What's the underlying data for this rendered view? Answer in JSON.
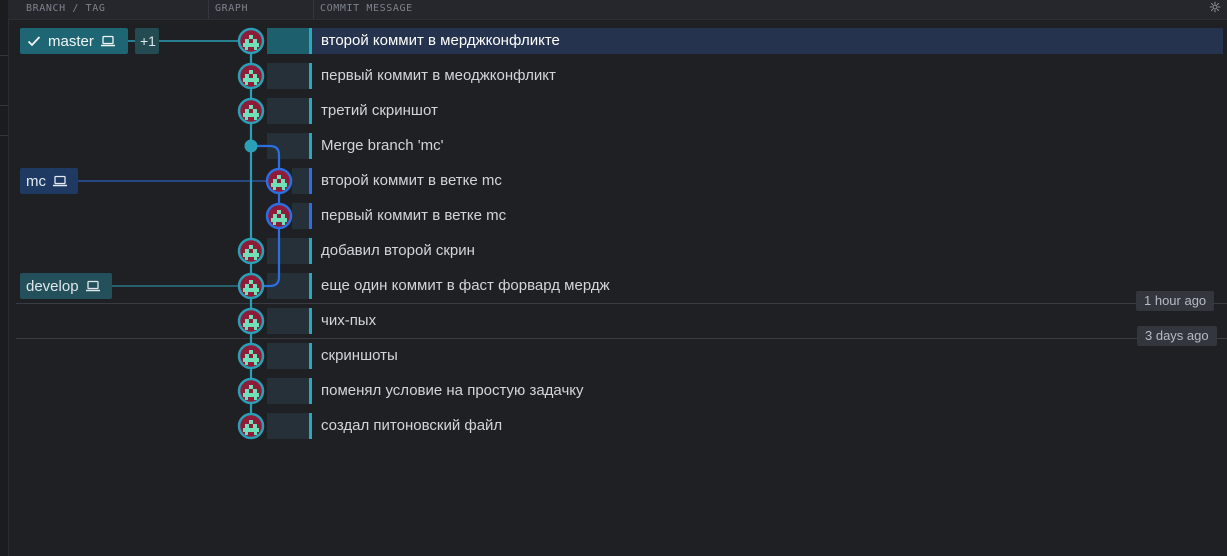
{
  "header": {
    "col_branch": "BRANCH / TAG",
    "col_graph": "GRAPH",
    "col_message": "COMMIT MESSAGE",
    "settings_icon": "gear-icon"
  },
  "refs": {
    "master": {
      "label": "master",
      "check_icon": "checkmark-icon",
      "local_icon": "laptop-icon",
      "extra": "+1"
    },
    "mc": {
      "label": "mc",
      "local_icon": "laptop-icon"
    },
    "develop": {
      "label": "develop",
      "local_icon": "laptop-icon"
    }
  },
  "commits": [
    {
      "message": "второй коммит в мерджконфликте",
      "lane": "main",
      "selected": true
    },
    {
      "message": "первый коммит в меоджконфликт",
      "lane": "main"
    },
    {
      "message": "третий скриншот",
      "lane": "main"
    },
    {
      "message": "Merge branch 'mc'",
      "lane": "main",
      "merge": true
    },
    {
      "message": "второй коммит в ветке mc",
      "lane": "mc"
    },
    {
      "message": "первый коммит в ветке mc",
      "lane": "mc"
    },
    {
      "message": "добавил второй скрин",
      "lane": "main"
    },
    {
      "message": "еще один коммит в фаст форвард мердж",
      "lane": "main"
    },
    {
      "message": "чих-пых",
      "lane": "main"
    },
    {
      "message": "скриншоты",
      "lane": "main"
    },
    {
      "message": "поменял условие на простую задачку",
      "lane": "main"
    },
    {
      "message": "создал питоновский файл",
      "lane": "main"
    }
  ],
  "time_markers": [
    {
      "label": "1 hour ago"
    },
    {
      "label": "3 days ago"
    }
  ],
  "colors": {
    "lane_main": "#2aa0b7",
    "lane_mc": "#2b6fe0",
    "avatar_bg": "#8e1b38",
    "avatar_face": "#6fe0b8"
  }
}
